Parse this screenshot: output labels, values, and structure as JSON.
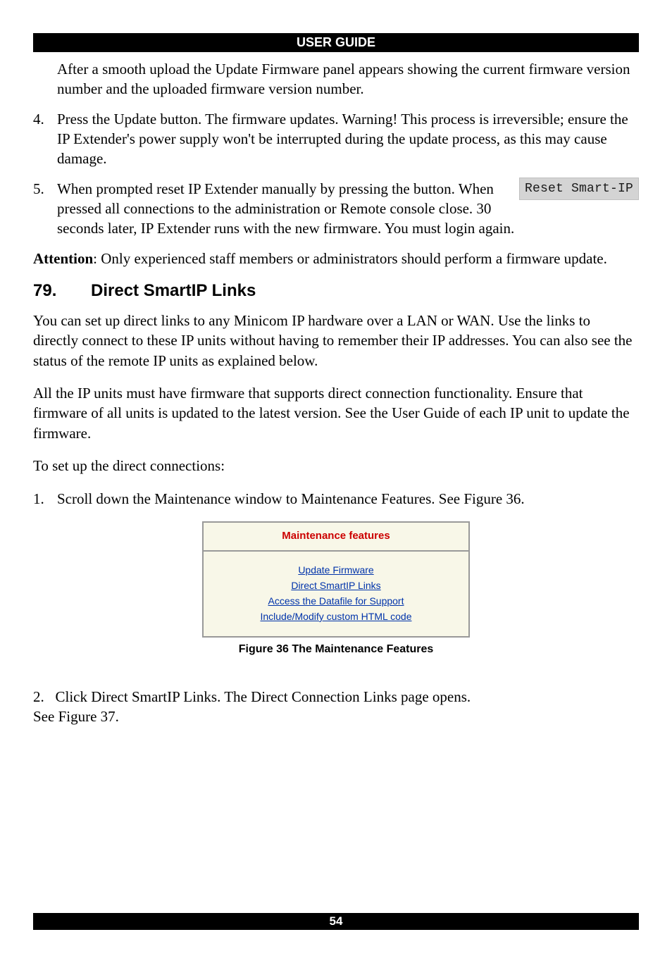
{
  "header": {
    "title": "USER GUIDE"
  },
  "upload_result_para": "After a smooth upload the Update Firmware panel appears showing the current firmware version number and the uploaded firmware version number.",
  "step4": {
    "number": "4.",
    "text": "Press the Update button. The firmware updates. Warning! This process is irreversible; ensure the IP Extender's power supply won't be interrupted during the update process, as this may cause damage."
  },
  "step5": {
    "number": "5.",
    "text_before_button": "When prompted reset IP Extender manually by pressing the ",
    "button_label": "Reset Smart-IP",
    "text_after_button": " button. When pressed all connections to the administration or Remote console close. 30 seconds later, IP Extender runs with the new firmware. You must login again."
  },
  "attention": {
    "label": "Attention",
    "text": ": Only experienced staff members or administrators should perform a firmware update."
  },
  "section": {
    "number": "79.",
    "title": "Direct SmartIP Links"
  },
  "para1": "You can set up direct links to any Minicom IP hardware over a LAN or WAN. Use the links to directly connect to these IP units without having to remember their IP addresses. You can also see the status of the remote IP units as explained below.",
  "para2": "All the IP units must have firmware that supports direct connection functionality. Ensure that firmware of all units is updated to the latest version. See the User Guide of each IP unit to update the firmware.",
  "para3": "To set up the direct connections:",
  "directStep1": {
    "number": "1.",
    "text": "Scroll down the Maintenance window to Maintenance Features. See Figure 36."
  },
  "figure": {
    "header": "Maintenance features",
    "links": [
      "Update Firmware",
      "Direct SmartIP Links",
      "Access the Datafile for Support",
      "Include/Modify custom HTML code"
    ],
    "caption": "Figure 36 The Maintenance Features"
  },
  "directStep2": {
    "number": "2.",
    "text_line1": "Click Direct SmartIP Links. The Direct Connection Links page opens.",
    "text_line2": "See Figure 37."
  },
  "footer": {
    "page_number": "54"
  }
}
